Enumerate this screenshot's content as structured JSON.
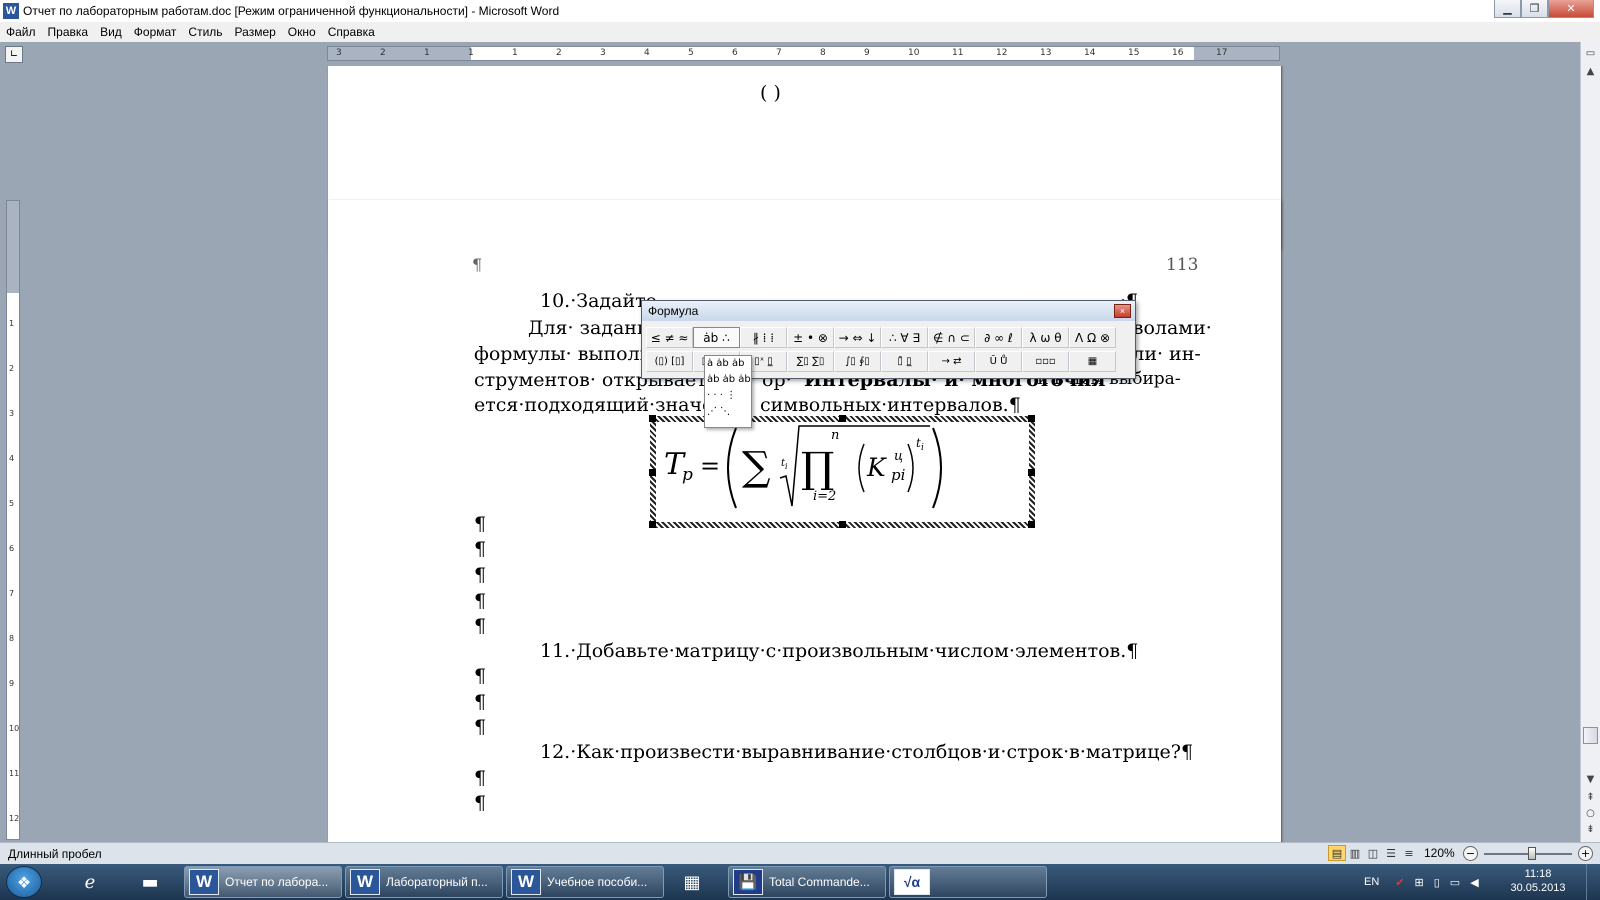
{
  "window": {
    "app_icon_letter": "W",
    "title": "Отчет по лабораторным работам.doc [Режим ограниченной функциональности] - Microsoft Word"
  },
  "menu": [
    "Файл",
    "Правка",
    "Вид",
    "Формат",
    "Стиль",
    "Размер",
    "Окно",
    "Справка"
  ],
  "hruler_numbers": [
    "3",
    "2",
    "1",
    "1",
    "1",
    "2",
    "3",
    "4",
    "5",
    "6",
    "7",
    "8",
    "9",
    "10",
    "11",
    "12",
    "13",
    "14",
    "15",
    "16",
    "17"
  ],
  "vruler_numbers": [
    "1",
    "2",
    "3",
    "4",
    "5",
    "6",
    "7",
    "8",
    "9",
    "10",
    "11",
    "12"
  ],
  "doc": {
    "page1_fragment": "(          )",
    "pilcrow": "¶",
    "page_number": "113",
    "item10": "10.·Задайте",
    "item10_end": "·¶",
    "para_l1a": "Для· задани",
    "para_l1b": "мволами·",
    "para_l2a": "формулы· выполн",
    "para_l2b": "ели· ин-",
    "para_l3a": "струментов· открывает",
    "para_l3b": "ор·",
    "para_l3c": "Интервалы· и· многоточия",
    "para_l3d": "·и·в·нем·выбира-",
    "para_l4a": "ется·подходящий·значо",
    "para_l4b": "символьных·интервалов.¶",
    "item11": "11.·Добавьте·матрицу·с·произвольным·числом·элементов.¶",
    "item12": "12.·Как·произвести·выравнивание·столбцов·и·строк·в·матрице?¶"
  },
  "formula": {
    "T": "T",
    "p_sub": "p",
    "eq": "=",
    "sum": "∑",
    "root_index": "t",
    "root_index_sub": "i",
    "prod": "∏",
    "top": "n",
    "bottom": "i=2",
    "K": "K",
    "K_sup": "ц",
    "K_sub": "pi",
    "exp": "t",
    "exp_sub": "i"
  },
  "formula_toolbar": {
    "title": "Формула",
    "close": "×",
    "row1": [
      "≤ ≠ ≈",
      "ȧb ∴",
      "∦ ⁞ ⁞",
      "± • ⊗",
      "→ ⇔ ↓",
      "∴ ∀ ∃",
      "∉ ∩ ⊂",
      "∂ ∞ ℓ",
      "λ ω θ",
      "Λ Ω ⊗"
    ],
    "row2": [
      "(▯) [▯]",
      "▯/▯ √▯",
      "▯ˣ ▯̲",
      "∑▯ ∑▯",
      "∫▯ ∮▯",
      "▯̄ ▯̲",
      "→ ⇄",
      "Ū Ů",
      "▫▫▫",
      "▦"
    ],
    "dropdown": [
      "ȧ ȧb ȧb",
      "ȧb ȧb ȧb",
      "· · · ⋮",
      "⋰ ⋱"
    ]
  },
  "status": {
    "text": "Длинный пробел",
    "zoom": "120%",
    "minus": "−",
    "plus": "+"
  },
  "taskbar": {
    "buttons": [
      {
        "label": "Отчет по лабора...",
        "icon": "W"
      },
      {
        "label": "Лабораторный п...",
        "icon": "W"
      },
      {
        "label": "Учебное пособи...",
        "icon": "W"
      },
      {
        "label": "Total Commande...",
        "icon": "💾"
      },
      {
        "label": "",
        "icon": "√α"
      }
    ],
    "lang": "EN",
    "time": "11:18",
    "date": "30.05.2013"
  },
  "colors": {
    "word_blue": "#2b579a",
    "chrome": "#9aa6b4"
  }
}
